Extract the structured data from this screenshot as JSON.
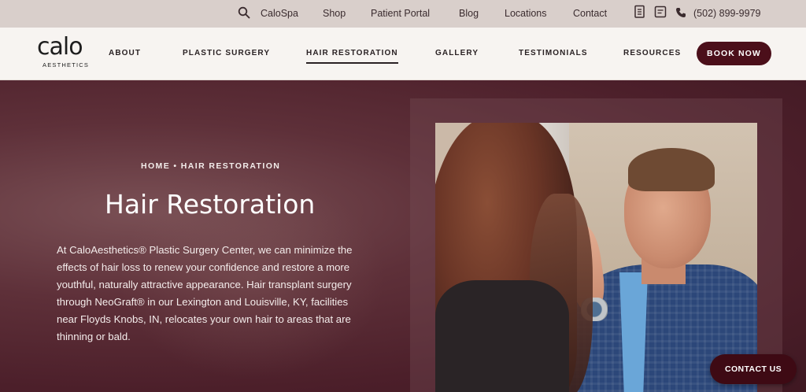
{
  "topbar": {
    "search_icon": "search-icon",
    "spa_label": "CaloSpa",
    "shop_label": "Shop",
    "portal_label": "Patient Portal",
    "blog_label": "Blog",
    "locations_label": "Locations",
    "contact_label": "Contact",
    "phone": "(502) 899-9979"
  },
  "logo": {
    "word": "calo",
    "sub": "AESTHETICS"
  },
  "nav": {
    "items": [
      {
        "label": "ABOUT"
      },
      {
        "label": "PLASTIC SURGERY"
      },
      {
        "label": "HAIR RESTORATION"
      },
      {
        "label": "GALLERY"
      },
      {
        "label": "TESTIMONIALS"
      },
      {
        "label": "RESOURCES"
      }
    ],
    "active_index": 2,
    "book_label": "BOOK NOW"
  },
  "hero": {
    "breadcrumb": "HOME • HAIR RESTORATION",
    "title": "Hair Restoration",
    "lede": "At CaloAesthetics® Plastic Surgery Center, we can minimize the effects of hair loss to renew your confidence and restore a more youthful, naturally attractive appearance. Hair transplant surgery through NeoGraft® in our Lexington and Louisville, KY, facilities near Floyds Knobs, IN, relocates your own hair to areas that are thinning or bald."
  },
  "contact_button": "CONTACT US",
  "colors": {
    "accent": "#4b0f1a",
    "topbar_bg": "#d9cfcb",
    "nav_bg": "#f7f4f1",
    "hero_bg": "#5a2a33"
  }
}
